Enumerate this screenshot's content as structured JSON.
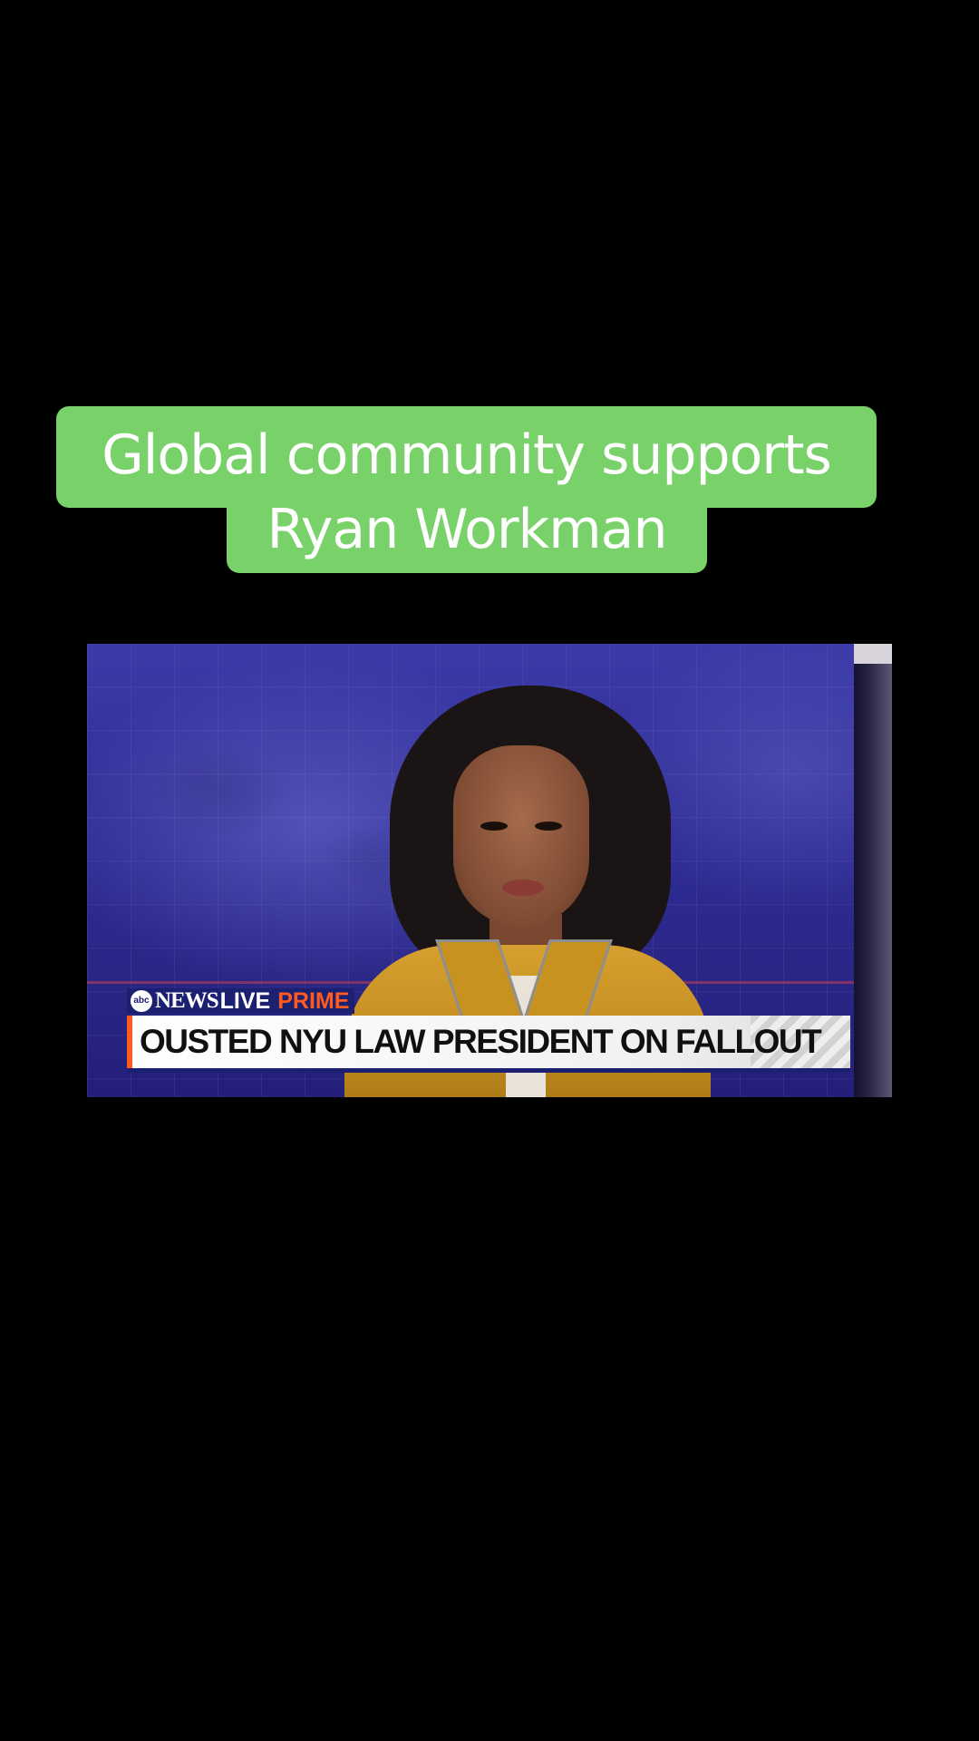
{
  "caption": {
    "line1": "Global community supports",
    "line2": "Ryan Workman",
    "background_color": "#79d16a",
    "text_color": "#ffffff"
  },
  "video": {
    "lower_third": {
      "logo_text": "abc",
      "brand_news": "NEWS",
      "brand_live": "LIVE",
      "brand_prime": "PRIME",
      "headline": "OUSTED NYU LAW PRESIDENT ON FALLOUT",
      "accent_color": "#ff5a1f",
      "brand_color": "#1b2170"
    }
  }
}
